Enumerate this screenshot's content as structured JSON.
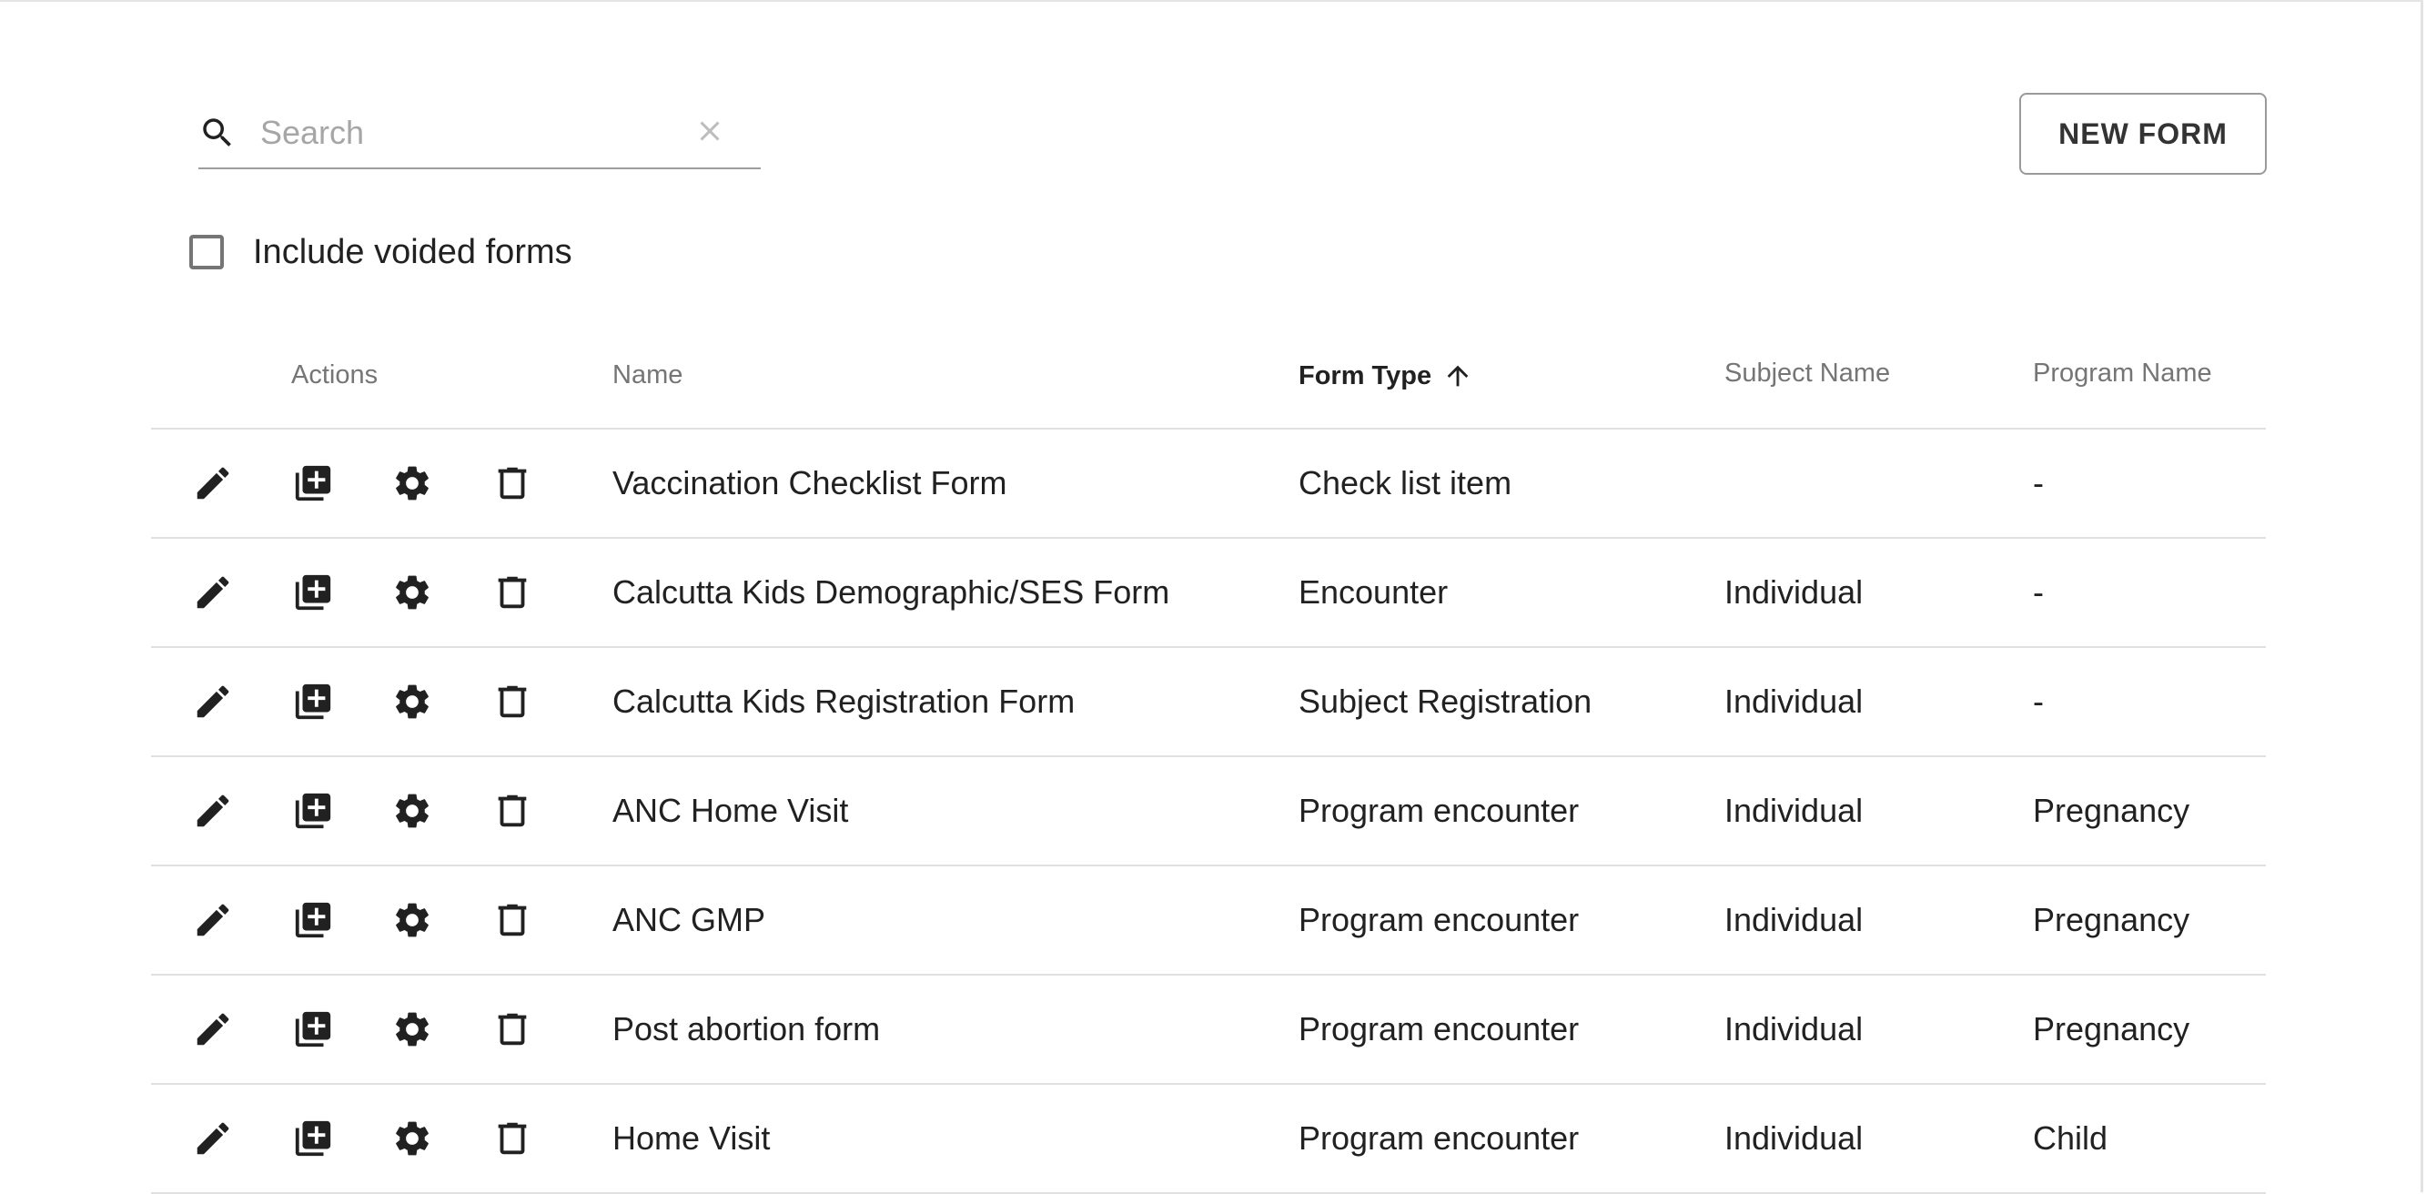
{
  "search": {
    "placeholder": "Search",
    "value": "",
    "icon": "search-icon",
    "clear_icon": "close-icon"
  },
  "toolbar": {
    "new_form_label": "NEW FORM"
  },
  "filter": {
    "include_voided_label": "Include voided forms",
    "include_voided_checked": false
  },
  "table": {
    "columns": [
      {
        "key": "actions",
        "label": "Actions"
      },
      {
        "key": "name",
        "label": "Name"
      },
      {
        "key": "form_type",
        "label": "Form Type",
        "sorted": "ascending"
      },
      {
        "key": "subject_name",
        "label": "Subject Name"
      },
      {
        "key": "program_name",
        "label": "Program Name"
      }
    ],
    "row_actions": [
      "edit-icon",
      "duplicate-icon",
      "settings-icon",
      "delete-icon"
    ],
    "rows": [
      {
        "name": "Vaccination Checklist Form",
        "form_type": "Check list item",
        "subject_name": "",
        "program_name": "-"
      },
      {
        "name": "Calcutta Kids Demographic/SES Form",
        "form_type": "Encounter",
        "subject_name": "Individual",
        "program_name": "-"
      },
      {
        "name": "Calcutta Kids Registration Form",
        "form_type": "Subject Registration",
        "subject_name": "Individual",
        "program_name": "-"
      },
      {
        "name": "ANC Home Visit",
        "form_type": "Program encounter",
        "subject_name": "Individual",
        "program_name": "Pregnancy"
      },
      {
        "name": "ANC GMP",
        "form_type": "Program encounter",
        "subject_name": "Individual",
        "program_name": "Pregnancy"
      },
      {
        "name": "Post abortion form",
        "form_type": "Program encounter",
        "subject_name": "Individual",
        "program_name": "Pregnancy"
      },
      {
        "name": "Home Visit",
        "form_type": "Program encounter",
        "subject_name": "Individual",
        "program_name": "Child"
      }
    ]
  }
}
